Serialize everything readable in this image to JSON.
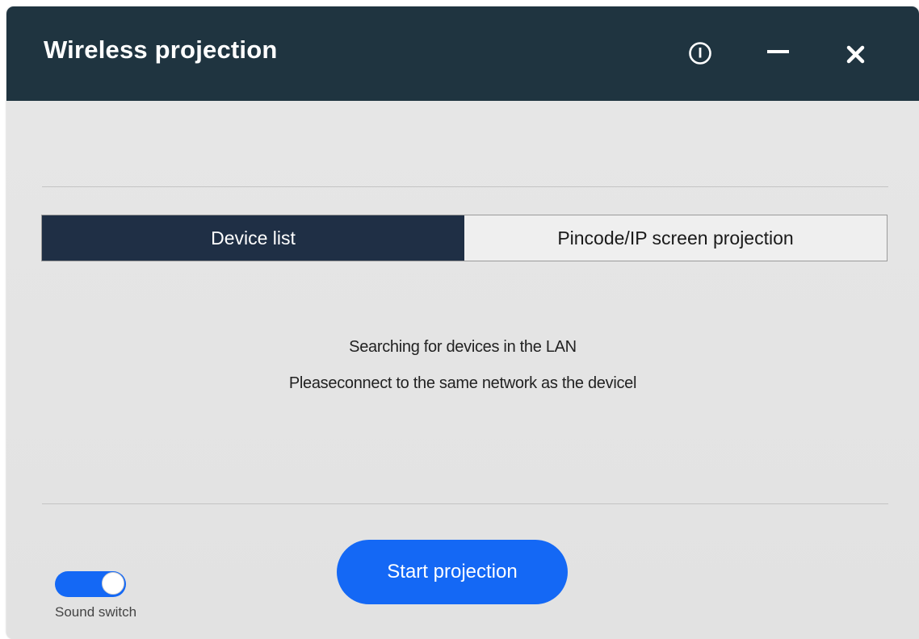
{
  "window": {
    "title": "Wireless projection",
    "buttons": {
      "info_icon": "info-circle-icon",
      "minimize_icon": "minimize-icon",
      "close_icon": "close-icon"
    }
  },
  "tabs": [
    {
      "label": "Device list",
      "active": true
    },
    {
      "label": "Pincode/IP screen projection",
      "active": false
    }
  ],
  "status": {
    "line1": "Searching for devices in the LAN",
    "line2": "Pleaseconnect to the same network as the devicel"
  },
  "actions": {
    "start_label": "Start projection"
  },
  "sound": {
    "label": "Sound switch",
    "enabled": true
  },
  "colors": {
    "titlebar": "#1f3440",
    "accent": "#1468f5",
    "tab_active": "#1f2f45"
  }
}
